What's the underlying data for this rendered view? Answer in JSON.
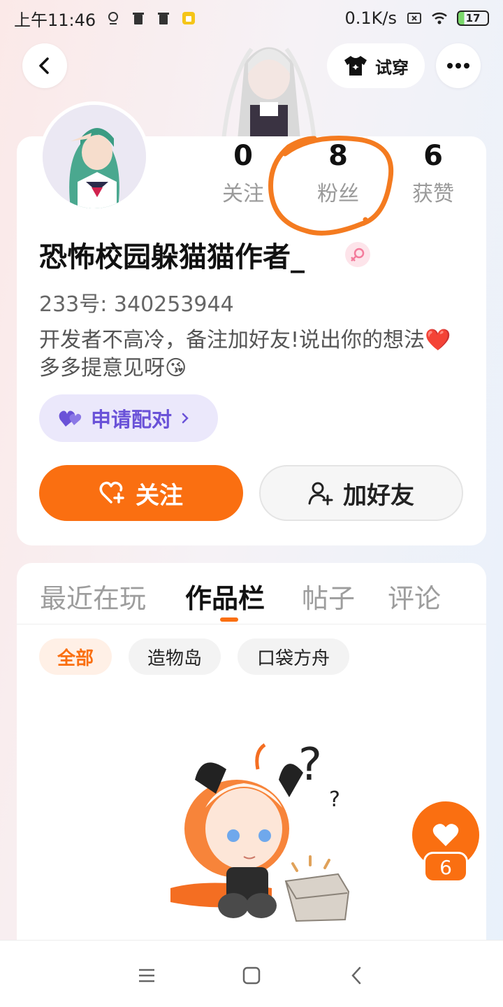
{
  "status_bar": {
    "time": "上午11:46",
    "network_speed": "0.1K/s",
    "battery": "17"
  },
  "header": {
    "tryon_label": "试穿"
  },
  "profile": {
    "stats": [
      {
        "value": "0",
        "label": "关注"
      },
      {
        "value": "8",
        "label": "粉丝"
      },
      {
        "value": "6",
        "label": "获赞"
      }
    ],
    "name": "恐怖校园躲猫猫作者_",
    "uid": "233号: 340253944",
    "bio": "开发者不高冷，备注加好友!说出你的想法❤️多多提意见呀😘",
    "pair_label": "申请配对",
    "follow_label": "关注",
    "add_friend_label": "加好友"
  },
  "tabs": [
    "最近在玩",
    "作品栏",
    "帖子",
    "评论"
  ],
  "active_tab": "作品栏",
  "filters": [
    "全部",
    "造物岛",
    "口袋方舟"
  ],
  "active_filter": "全部",
  "fab": {
    "count": "6"
  },
  "colors": {
    "accent": "#fa6f11",
    "pair_purple": "#6a52d8",
    "annotation": "#f47b20"
  }
}
